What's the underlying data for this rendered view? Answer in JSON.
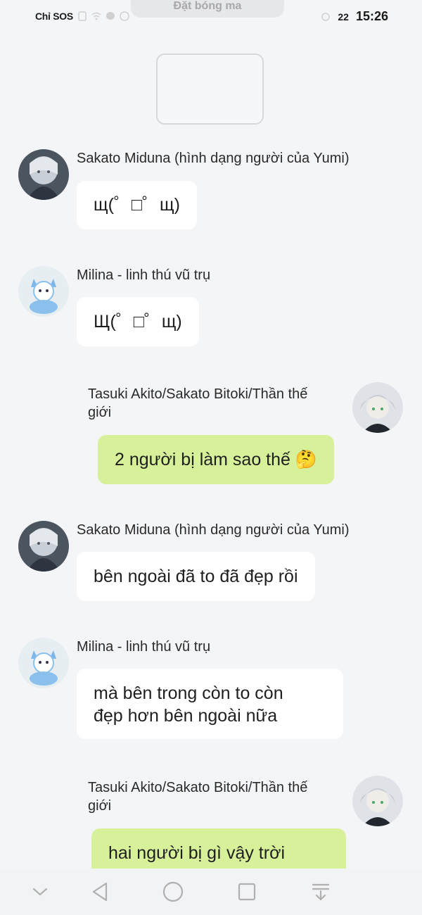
{
  "status_bar": {
    "carrier": "Chỉ SOS",
    "left_icons": [
      "sim-icon",
      "wifi-icon",
      "messenger-icon",
      "facebook-icon"
    ],
    "network": "22",
    "time": "15:26"
  },
  "top_banner": {
    "text": "Đặt bóng ma"
  },
  "messages": [
    {
      "sender": "Sakato Miduna (hình dạng người của Yumi)",
      "text": "щ(゜□゜щ)",
      "side": "left",
      "avatar": "avatar-miduna"
    },
    {
      "sender": "Milina - linh thú vũ trụ",
      "text": "Щ(゜□゜щ)",
      "side": "left",
      "avatar": "avatar-milina"
    },
    {
      "sender_line1": "Tasuki Akito/Sakato Bitoki/Thần thế",
      "sender_line2": "giới",
      "text": "2 người bị làm sao thế 🤔",
      "side": "right",
      "avatar": "avatar-tasuki"
    },
    {
      "sender": "Sakato Miduna (hình dạng người của Yumi)",
      "text": "bên ngoài đã to đã đẹp rồi",
      "side": "left",
      "avatar": "avatar-miduna"
    },
    {
      "sender": "Milina - linh thú vũ trụ",
      "text_line1": "mà bên trong còn to còn",
      "text_line2": "đẹp hơn bên ngoài nữa",
      "side": "left",
      "avatar": "avatar-milina"
    },
    {
      "sender_line1": "Tasuki Akito/Sakato Bitoki/Thần thế",
      "sender_line2": "giới",
      "text": "hai người bị gì vậy trời",
      "side": "right",
      "avatar": "avatar-tasuki"
    }
  ],
  "nav_bar": {
    "buttons": [
      "chevron-down-icon",
      "back-triangle-icon",
      "home-circle-icon",
      "recents-square-icon",
      "download-tray-icon"
    ]
  },
  "colors": {
    "background": "#f4f5f7",
    "bubble_other": "#ffffff",
    "bubble_mine": "#d7f19b",
    "nav_icon": "#b0b0b0"
  }
}
